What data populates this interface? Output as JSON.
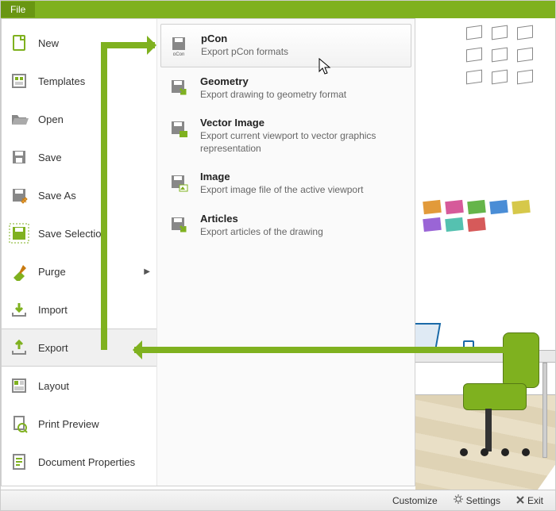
{
  "menubar": {
    "file": "File"
  },
  "file_menu": {
    "items": [
      {
        "label": "New"
      },
      {
        "label": "Templates"
      },
      {
        "label": "Open"
      },
      {
        "label": "Save"
      },
      {
        "label": "Save As"
      },
      {
        "label": "Save Selection"
      },
      {
        "label": "Purge",
        "has_submenu": true
      },
      {
        "label": "Import"
      },
      {
        "label": "Export",
        "selected": true
      },
      {
        "label": "Layout"
      },
      {
        "label": "Print Preview"
      },
      {
        "label": "Document Properties"
      }
    ]
  },
  "export_submenu": {
    "items": [
      {
        "title": "pCon",
        "desc": "Export pCon formats",
        "highlight": true
      },
      {
        "title": "Geometry",
        "desc": "Export drawing to geometry format"
      },
      {
        "title": "Vector Image",
        "desc": "Export current viewport to vector graphics representation"
      },
      {
        "title": "Image",
        "desc": "Export image file of the active viewport"
      },
      {
        "title": "Articles",
        "desc": "Export articles of the drawing"
      }
    ]
  },
  "statusbar": {
    "customize": "Customize",
    "settings": "Settings",
    "exit": "Exit"
  },
  "colors": {
    "accent": "#7fb11f"
  }
}
